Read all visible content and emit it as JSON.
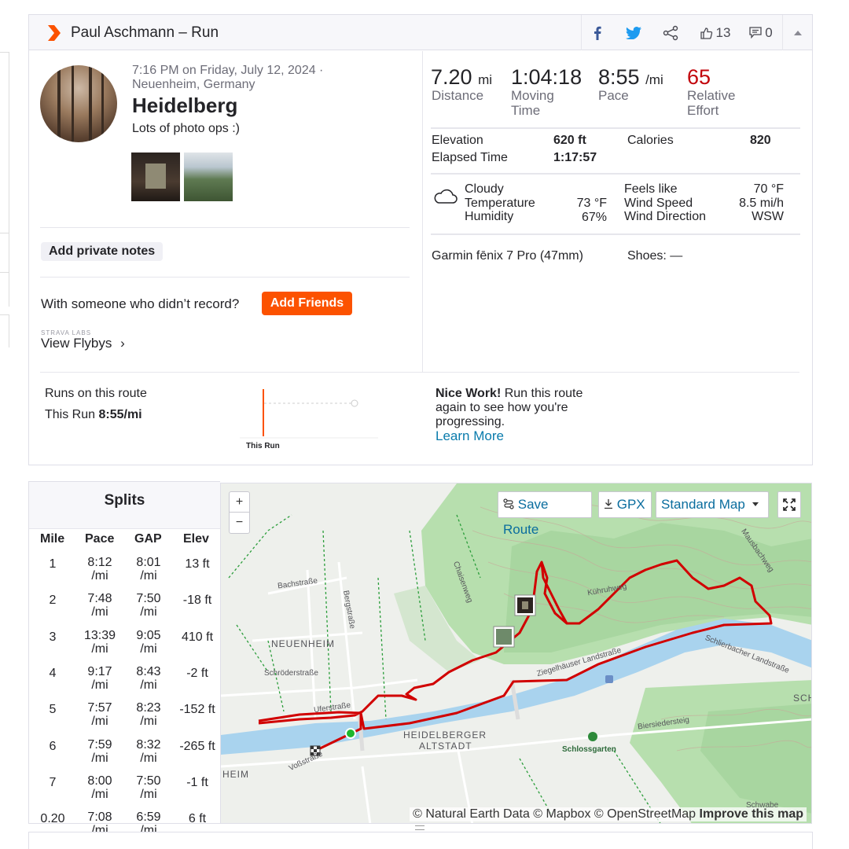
{
  "header": {
    "title": "Paul Aschmann – Run",
    "kudos_count": "13",
    "comment_count": "0"
  },
  "activity": {
    "time": "7:16 PM on Friday, July 12, 2024 ·",
    "location": "Neuenheim, Germany",
    "title": "Heidelberg",
    "description": "Lots of photo ops :)",
    "private_notes_label": "Add private notes",
    "with_someone_text": "With someone who didn’t record?",
    "add_friends_label": "Add Friends",
    "strava_labs": "STRAVA LABS",
    "view_flybys": "View Flybys",
    "view_flybys_arrow": "›"
  },
  "stats": {
    "distance_value": "7.20",
    "distance_unit": "mi",
    "distance_label": "Distance",
    "moving_time_value": "1:04:18",
    "moving_time_label_1": "Moving",
    "moving_time_label_2": "Time",
    "pace_value": "8:55",
    "pace_unit": "/mi",
    "pace_label": "Pace",
    "effort_value": "65",
    "effort_label_1": "Relative",
    "effort_label_2": "Effort",
    "elevation_label": "Elevation",
    "elevation_value": "620 ft",
    "calories_label": "Calories",
    "calories_value": "820",
    "elapsed_label": "Elapsed Time",
    "elapsed_value": "1:17:57"
  },
  "weather": {
    "condition": "Cloudy",
    "temperature_label": "Temperature",
    "temperature_value": "73 °F",
    "humidity_label": "Humidity",
    "humidity_value": "67%",
    "feels_like_label": "Feels like",
    "feels_like_value": "70 °F",
    "wind_speed_label": "Wind Speed",
    "wind_speed_value": "8.5 mi/h",
    "wind_dir_label": "Wind Direction",
    "wind_dir_value": "WSW"
  },
  "gear": {
    "device": "Garmin fēnix 7 Pro (47mm)",
    "shoes": "Shoes: —"
  },
  "route": {
    "runs_on_route": "Runs on this route",
    "this_run_label": "This Run",
    "this_run_pace": "8:55/mi",
    "chart_label": "This Run",
    "nice_work_bold": "Nice Work!",
    "nice_work_text": " Run this route again to see how you're progressing.",
    "learn_more": "Learn More"
  },
  "splits": {
    "title": "Splits",
    "headers": [
      "Mile",
      "Pace",
      "GAP",
      "Elev"
    ],
    "rows": [
      {
        "mile": "1",
        "pace": "8:12",
        "gap": "8:01",
        "elev": "13 ft"
      },
      {
        "mile": "2",
        "pace": "7:48",
        "gap": "7:50",
        "elev": "-18 ft"
      },
      {
        "mile": "3",
        "pace": "13:39",
        "gap": "9:05",
        "elev": "410 ft"
      },
      {
        "mile": "4",
        "pace": "9:17",
        "gap": "8:43",
        "elev": "-2 ft"
      },
      {
        "mile": "5",
        "pace": "7:57",
        "gap": "8:23",
        "elev": "-152 ft"
      },
      {
        "mile": "6",
        "pace": "7:59",
        "gap": "8:32",
        "elev": "-265 ft"
      },
      {
        "mile": "7",
        "pace": "8:00",
        "gap": "7:50",
        "elev": "-1 ft"
      },
      {
        "mile": "0.20",
        "pace": "7:08",
        "gap": "6:59",
        "elev": "6 ft"
      }
    ],
    "unit": "/mi"
  },
  "map": {
    "zoom_in": "+",
    "zoom_out": "−",
    "save_route": "Save Route",
    "gpx": "GPX",
    "standard_map": "Standard Map",
    "attribution": "© Natural Earth Data © Mapbox © OpenStreetMap ",
    "improve": "Improve this map",
    "labels": {
      "neuenheim": "NEUENHEIM",
      "altstadt_1": "HEIDELBERGER",
      "altstadt_2": "ALTSTADT",
      "schlossgarten": "Schlossgarten",
      "bachstrasse": "Bachstraße",
      "bergstrasse": "Bergstraße",
      "schroederstrasse": "Schröderstraße",
      "uferstrasse": "Uferstraße",
      "vossstrasse": "Voßstraße",
      "heim": "HEIM",
      "ziegelhaeuser": "Ziegelhäuser Landstraße",
      "schlierbacher": "Schlierbacher Landstraße",
      "kuehruhweg": "Kühruhweg",
      "chaisenweg": "Chaisenweg",
      "mausbachweg": "Mausbachweg",
      "biersiedersteig": "Biersiedersteig",
      "sch": "SCH",
      "schwabe": "Schwabe"
    }
  },
  "colors": {
    "brand": "#fc5200",
    "effort": "#c2050c",
    "link": "#0a7bac",
    "route": "#d10000",
    "river": "#a9d3ee",
    "forest": "#a8d6a0"
  }
}
